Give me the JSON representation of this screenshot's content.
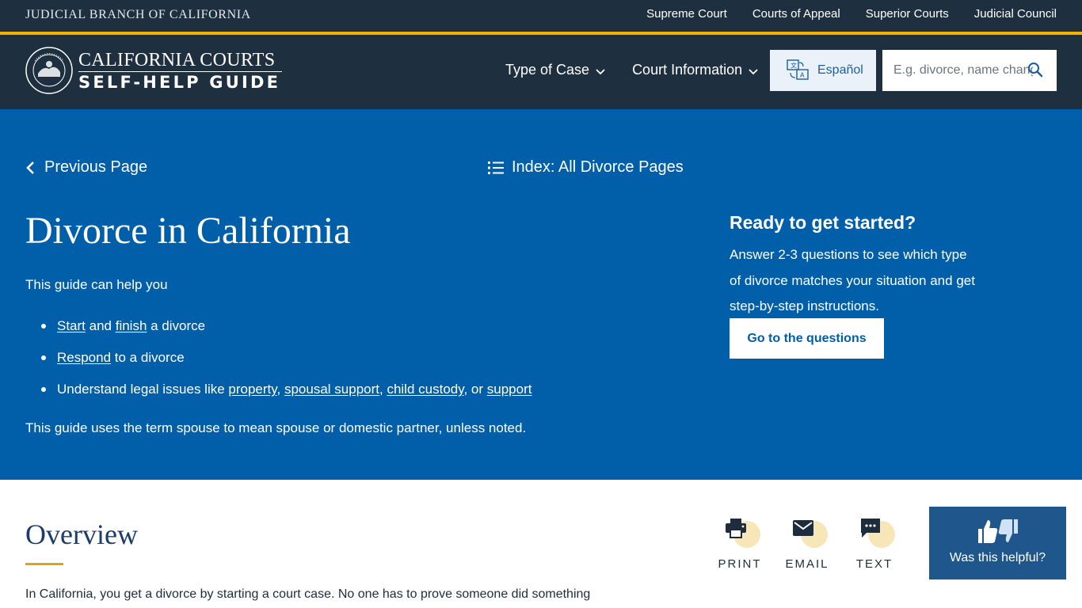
{
  "topbar": {
    "title": "JUDICIAL BRANCH OF CALIFORNIA",
    "links": [
      "Supreme Court",
      "Courts of Appeal",
      "Superior Courts",
      "Judicial Council"
    ]
  },
  "header": {
    "brand_line1": "CALIFORNIA COURTS",
    "brand_line2": "SELF-HELP GUIDE",
    "nav": [
      "Type of Case",
      "Court Information"
    ],
    "language_button": "Español",
    "search_placeholder": "E.g. divorce, name change,"
  },
  "hero": {
    "prev_link": "Previous Page",
    "index_link": "Index: All Divorce Pages",
    "title": "Divorce in California",
    "intro": "This guide can help you",
    "list": {
      "item1": {
        "link1": "Start",
        "text1": " and ",
        "link2": "finish",
        "text2": " a divorce"
      },
      "item2": {
        "link1": "Respond",
        "text1": " to a divorce"
      },
      "item3": {
        "text1": "Understand legal issues like ",
        "link1": "property",
        "sep1": ", ",
        "link2": "spousal support",
        "sep2": ", ",
        "link3": "child custody",
        "sep3": ", or ",
        "link4": "support"
      }
    },
    "note": "This guide uses the term spouse to mean spouse or domestic partner, unless noted.",
    "ready": {
      "title": "Ready to get started?",
      "text": "Answer 2-3 questions to see which type of divorce matches your situation and get step-by-step instructions.",
      "button": "Go to the questions"
    }
  },
  "overview": {
    "title": "Overview",
    "text": "In California, you get a divorce by starting a court case. No one has to prove someone did something",
    "share": {
      "print": "PRINT",
      "email": "EMAIL",
      "text": "TEXT"
    },
    "helpful": "Was this helpful?"
  },
  "colors": {
    "header_bg": "#1e2f40",
    "accent_gold": "#f2b100",
    "hero_blue": "#005fa8",
    "helpful_bg": "#1f578c"
  }
}
